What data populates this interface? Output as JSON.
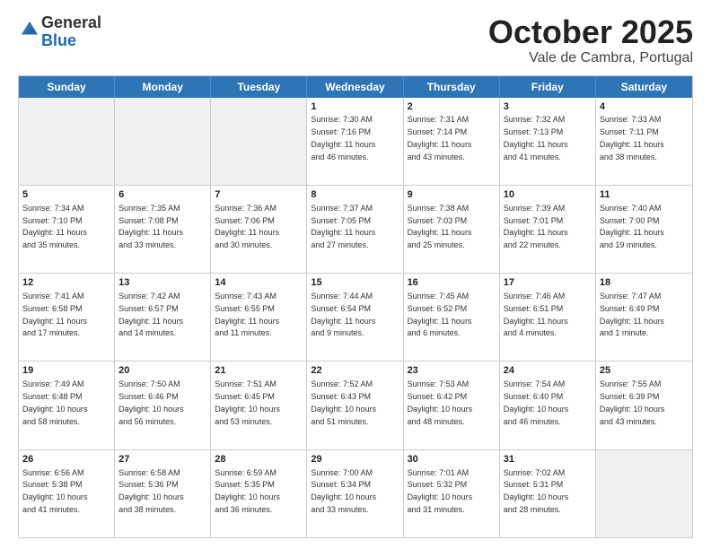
{
  "header": {
    "logo_general": "General",
    "logo_blue": "Blue",
    "month_title": "October 2025",
    "location": "Vale de Cambra, Portugal"
  },
  "weekdays": [
    "Sunday",
    "Monday",
    "Tuesday",
    "Wednesday",
    "Thursday",
    "Friday",
    "Saturday"
  ],
  "rows": [
    [
      {
        "day": "",
        "text": "",
        "shaded": true
      },
      {
        "day": "",
        "text": "",
        "shaded": true
      },
      {
        "day": "",
        "text": "",
        "shaded": true
      },
      {
        "day": "1",
        "text": "Sunrise: 7:30 AM\nSunset: 7:16 PM\nDaylight: 11 hours\nand 46 minutes."
      },
      {
        "day": "2",
        "text": "Sunrise: 7:31 AM\nSunset: 7:14 PM\nDaylight: 11 hours\nand 43 minutes."
      },
      {
        "day": "3",
        "text": "Sunrise: 7:32 AM\nSunset: 7:13 PM\nDaylight: 11 hours\nand 41 minutes."
      },
      {
        "day": "4",
        "text": "Sunrise: 7:33 AM\nSunset: 7:11 PM\nDaylight: 11 hours\nand 38 minutes."
      }
    ],
    [
      {
        "day": "5",
        "text": "Sunrise: 7:34 AM\nSunset: 7:10 PM\nDaylight: 11 hours\nand 35 minutes."
      },
      {
        "day": "6",
        "text": "Sunrise: 7:35 AM\nSunset: 7:08 PM\nDaylight: 11 hours\nand 33 minutes."
      },
      {
        "day": "7",
        "text": "Sunrise: 7:36 AM\nSunset: 7:06 PM\nDaylight: 11 hours\nand 30 minutes."
      },
      {
        "day": "8",
        "text": "Sunrise: 7:37 AM\nSunset: 7:05 PM\nDaylight: 11 hours\nand 27 minutes."
      },
      {
        "day": "9",
        "text": "Sunrise: 7:38 AM\nSunset: 7:03 PM\nDaylight: 11 hours\nand 25 minutes."
      },
      {
        "day": "10",
        "text": "Sunrise: 7:39 AM\nSunset: 7:01 PM\nDaylight: 11 hours\nand 22 minutes."
      },
      {
        "day": "11",
        "text": "Sunrise: 7:40 AM\nSunset: 7:00 PM\nDaylight: 11 hours\nand 19 minutes."
      }
    ],
    [
      {
        "day": "12",
        "text": "Sunrise: 7:41 AM\nSunset: 6:58 PM\nDaylight: 11 hours\nand 17 minutes."
      },
      {
        "day": "13",
        "text": "Sunrise: 7:42 AM\nSunset: 6:57 PM\nDaylight: 11 hours\nand 14 minutes."
      },
      {
        "day": "14",
        "text": "Sunrise: 7:43 AM\nSunset: 6:55 PM\nDaylight: 11 hours\nand 11 minutes."
      },
      {
        "day": "15",
        "text": "Sunrise: 7:44 AM\nSunset: 6:54 PM\nDaylight: 11 hours\nand 9 minutes."
      },
      {
        "day": "16",
        "text": "Sunrise: 7:45 AM\nSunset: 6:52 PM\nDaylight: 11 hours\nand 6 minutes."
      },
      {
        "day": "17",
        "text": "Sunrise: 7:46 AM\nSunset: 6:51 PM\nDaylight: 11 hours\nand 4 minutes."
      },
      {
        "day": "18",
        "text": "Sunrise: 7:47 AM\nSunset: 6:49 PM\nDaylight: 11 hours\nand 1 minute."
      }
    ],
    [
      {
        "day": "19",
        "text": "Sunrise: 7:49 AM\nSunset: 6:48 PM\nDaylight: 10 hours\nand 58 minutes."
      },
      {
        "day": "20",
        "text": "Sunrise: 7:50 AM\nSunset: 6:46 PM\nDaylight: 10 hours\nand 56 minutes."
      },
      {
        "day": "21",
        "text": "Sunrise: 7:51 AM\nSunset: 6:45 PM\nDaylight: 10 hours\nand 53 minutes."
      },
      {
        "day": "22",
        "text": "Sunrise: 7:52 AM\nSunset: 6:43 PM\nDaylight: 10 hours\nand 51 minutes."
      },
      {
        "day": "23",
        "text": "Sunrise: 7:53 AM\nSunset: 6:42 PM\nDaylight: 10 hours\nand 48 minutes."
      },
      {
        "day": "24",
        "text": "Sunrise: 7:54 AM\nSunset: 6:40 PM\nDaylight: 10 hours\nand 46 minutes."
      },
      {
        "day": "25",
        "text": "Sunrise: 7:55 AM\nSunset: 6:39 PM\nDaylight: 10 hours\nand 43 minutes."
      }
    ],
    [
      {
        "day": "26",
        "text": "Sunrise: 6:56 AM\nSunset: 5:38 PM\nDaylight: 10 hours\nand 41 minutes."
      },
      {
        "day": "27",
        "text": "Sunrise: 6:58 AM\nSunset: 5:36 PM\nDaylight: 10 hours\nand 38 minutes."
      },
      {
        "day": "28",
        "text": "Sunrise: 6:59 AM\nSunset: 5:35 PM\nDaylight: 10 hours\nand 36 minutes."
      },
      {
        "day": "29",
        "text": "Sunrise: 7:00 AM\nSunset: 5:34 PM\nDaylight: 10 hours\nand 33 minutes."
      },
      {
        "day": "30",
        "text": "Sunrise: 7:01 AM\nSunset: 5:32 PM\nDaylight: 10 hours\nand 31 minutes."
      },
      {
        "day": "31",
        "text": "Sunrise: 7:02 AM\nSunset: 5:31 PM\nDaylight: 10 hours\nand 28 minutes."
      },
      {
        "day": "",
        "text": "",
        "shaded": true
      }
    ]
  ]
}
